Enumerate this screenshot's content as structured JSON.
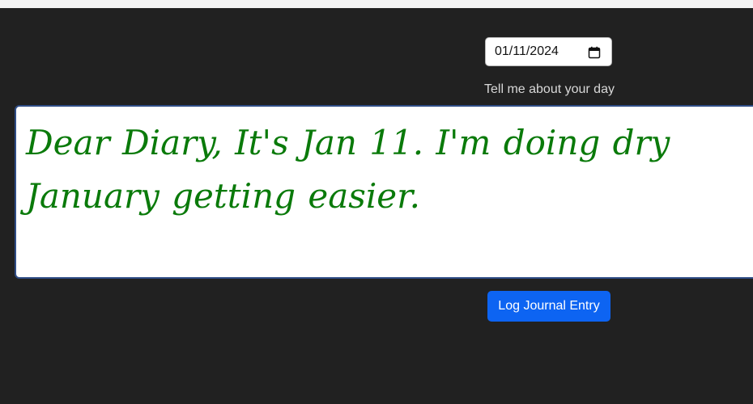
{
  "journal": {
    "date_value": "01/11/2024",
    "prompt_label": "Tell me about your day",
    "entry_text": "Dear Diary, It's Jan 11. I'm doing dry January getting easier.",
    "submit_label": "Log Journal Entry"
  },
  "icons": {
    "date_picker": "calendar-icon"
  },
  "colors": {
    "background": "#212121",
    "entry_text": "#0a7a0a",
    "button": "#0d64f2",
    "entry_border": "#2f4d86"
  }
}
